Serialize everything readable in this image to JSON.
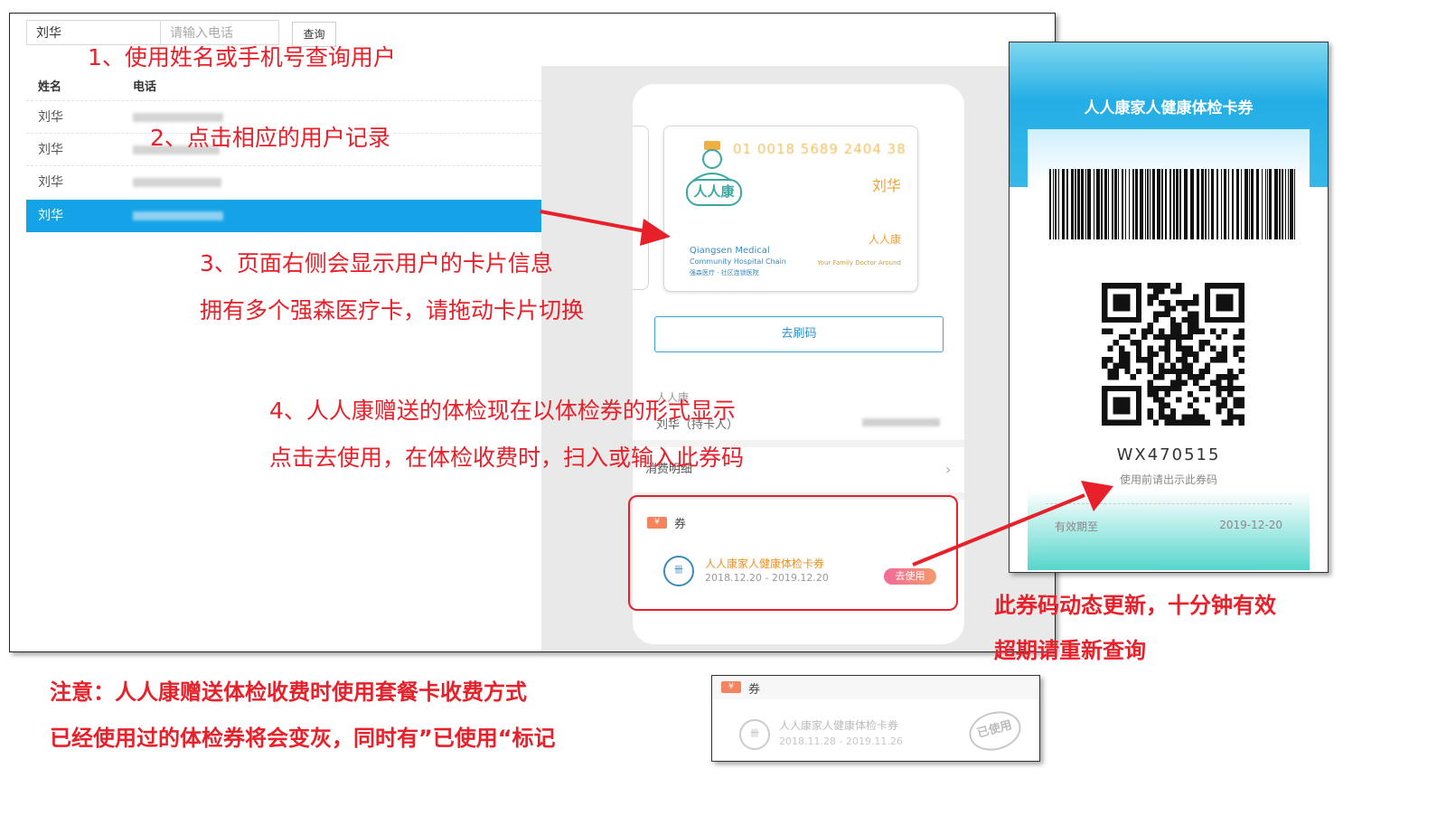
{
  "search": {
    "name_value": "刘华",
    "phone_placeholder": "请输入电话",
    "query_label": "查询"
  },
  "table": {
    "headers": [
      "姓名",
      "电话"
    ],
    "rows": [
      {
        "name": "刘华"
      },
      {
        "name": "刘华"
      },
      {
        "name": "刘华"
      },
      {
        "name": "刘华"
      }
    ]
  },
  "card": {
    "number": "01 0018 5689 2404 38",
    "holder": "刘华",
    "brand": "人人康",
    "logo_text": "人人康",
    "en_line1": "Qiangsen Medical",
    "en_line2": "Community Hospital Chain",
    "en_line3": "强森医疗 · 社区连锁医院",
    "slogan": "Your Family Doctor Around"
  },
  "phone_view": {
    "brush_button": "去刷码",
    "holder_title": "人人康",
    "holder_name": "刘华（持卡人）",
    "detail_label": "消费明细",
    "coupon_section_label": "券",
    "coupon": {
      "title": "人人康家人健康体检卡券",
      "date_range": "2018.12.20 - 2019.12.20",
      "use_button": "去使用"
    }
  },
  "ticket": {
    "title": "人人康家人健康体检卡券",
    "code": "WX470515",
    "hint": "使用前请出示此券码",
    "valid_label": "有效期至",
    "valid_date": "2019-12-20"
  },
  "used_coupon": {
    "section_label": "券",
    "title": "人人康家人健康体检卡券",
    "date_range": "2018.11.28 - 2019.11.26",
    "stamp": "已使用"
  },
  "annotations": {
    "step1": "1、使用姓名或手机号查询用户",
    "step2": "2、点击相应的用户记录",
    "step3_line1": "3、页面右侧会显示用户的卡片信息",
    "step3_line2": "拥有多个强森医疗卡，请拖动卡片切换",
    "step4_line1": "4、人人康赠送的体检现在以体检券的形式显示",
    "step4_line2": "点击去使用，在体检收费时，扫入或输入此券码",
    "dynamic_line1": "此券码动态更新，十分钟有效",
    "dynamic_line2": "超期请重新查询",
    "note_line1": "注意：人人康赠送体检收费时使用套餐卡收费方式",
    "note_line2": "已经使用过的体检券将会变灰，同时有”已使用“标记"
  },
  "colors": {
    "annotation_red": "#e8202a",
    "selected_row": "#14a3e6",
    "coupon_orange": "#f09020"
  }
}
